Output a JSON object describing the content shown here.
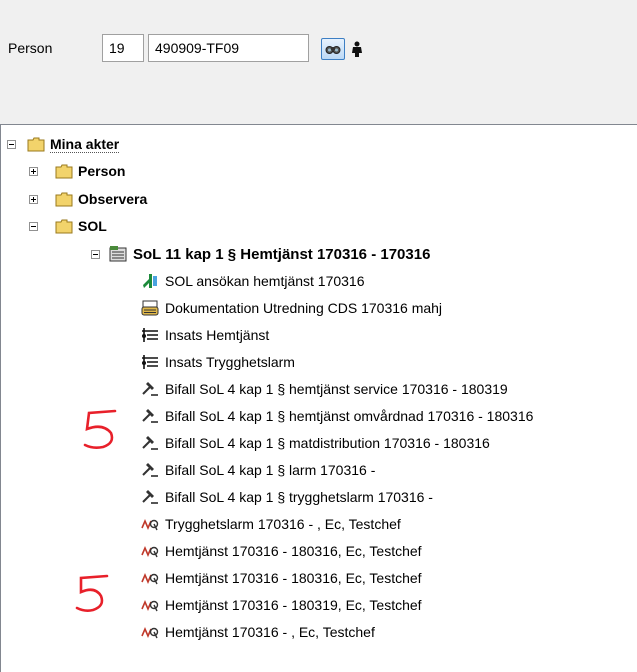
{
  "form": {
    "person_label": "Person",
    "century_value": "19",
    "personnummer_value": "490909-TF09"
  },
  "tree": {
    "root": "Mina akter",
    "folders": {
      "person": "Person",
      "observera": "Observera",
      "sol": "SOL"
    },
    "case": "SoL 11 kap 1 § Hemtjänst 170316 - 170316",
    "items": [
      "SOL ansökan hemtjänst 170316",
      "Dokumentation Utredning CDS 170316 mahj",
      "Insats Hemtjänst",
      "Insats Trygghetslarm",
      "Bifall SoL 4 kap 1 § hemtjänst service 170316 - 180319",
      "Bifall SoL 4 kap 1 § hemtjänst omvårdnad 170316 - 180316",
      "Bifall SoL 4 kap 1 § matdistribution 170316 - 180316",
      "Bifall SoL 4 kap 1 § larm 170316 -",
      "Bifall SoL 4 kap 1 § trygghetslarm 170316 -",
      "Trygghetslarm 170316 - , Ec, Testchef",
      "Hemtjänst 170316 - 180316, Ec, Testchef",
      "Hemtjänst 170316 - 180316, Ec, Testchef",
      "Hemtjänst 170316 - 180319, Ec, Testchef",
      "Hemtjänst 170316 - , Ec, Testchef"
    ]
  },
  "annotations": {
    "mark1": "5",
    "mark2": "5"
  },
  "colors": {
    "folder": "#f2d36b",
    "annotation": "#e8202a",
    "button_border": "#3d7fc4"
  }
}
